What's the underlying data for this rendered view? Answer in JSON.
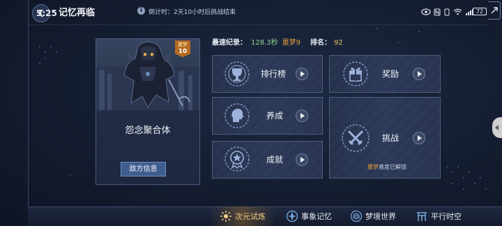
{
  "statusbar": {
    "time": "5:25",
    "battery": "72"
  },
  "header": {
    "title": "记忆再临",
    "countdown": "倒计时：2天10小时后挑战结束"
  },
  "boss": {
    "name": "怨念聚合体",
    "badge_label": "噩梦",
    "badge_level": "10",
    "info_button": "敌方信息"
  },
  "records": {
    "fastest_label": "最速纪录：",
    "fastest_time": "128.3秒",
    "difficulty": "噩梦9",
    "rank_label": "排名：",
    "rank_value": "92"
  },
  "tiles": {
    "leaderboard": "排行榜",
    "rewards": "奖励",
    "develop": "养成",
    "achievements": "成就",
    "challenge": "挑战",
    "challenge_sub_highlight": "噩梦",
    "challenge_sub_rest": "难度已解锁"
  },
  "bottom_nav": [
    {
      "label": "次元试炼",
      "icon": "sunburst-icon"
    },
    {
      "label": "事象记忆",
      "icon": "flower-icon"
    },
    {
      "label": "梦境世界",
      "icon": "fingerprint-icon"
    },
    {
      "label": "平行时空",
      "icon": "gate-icon"
    }
  ],
  "colors": {
    "accent_gold": "#e5a13c",
    "time_green": "#8ed48a",
    "rank_yellow": "#e5c15a",
    "button_blue": "#3f5e8e"
  }
}
